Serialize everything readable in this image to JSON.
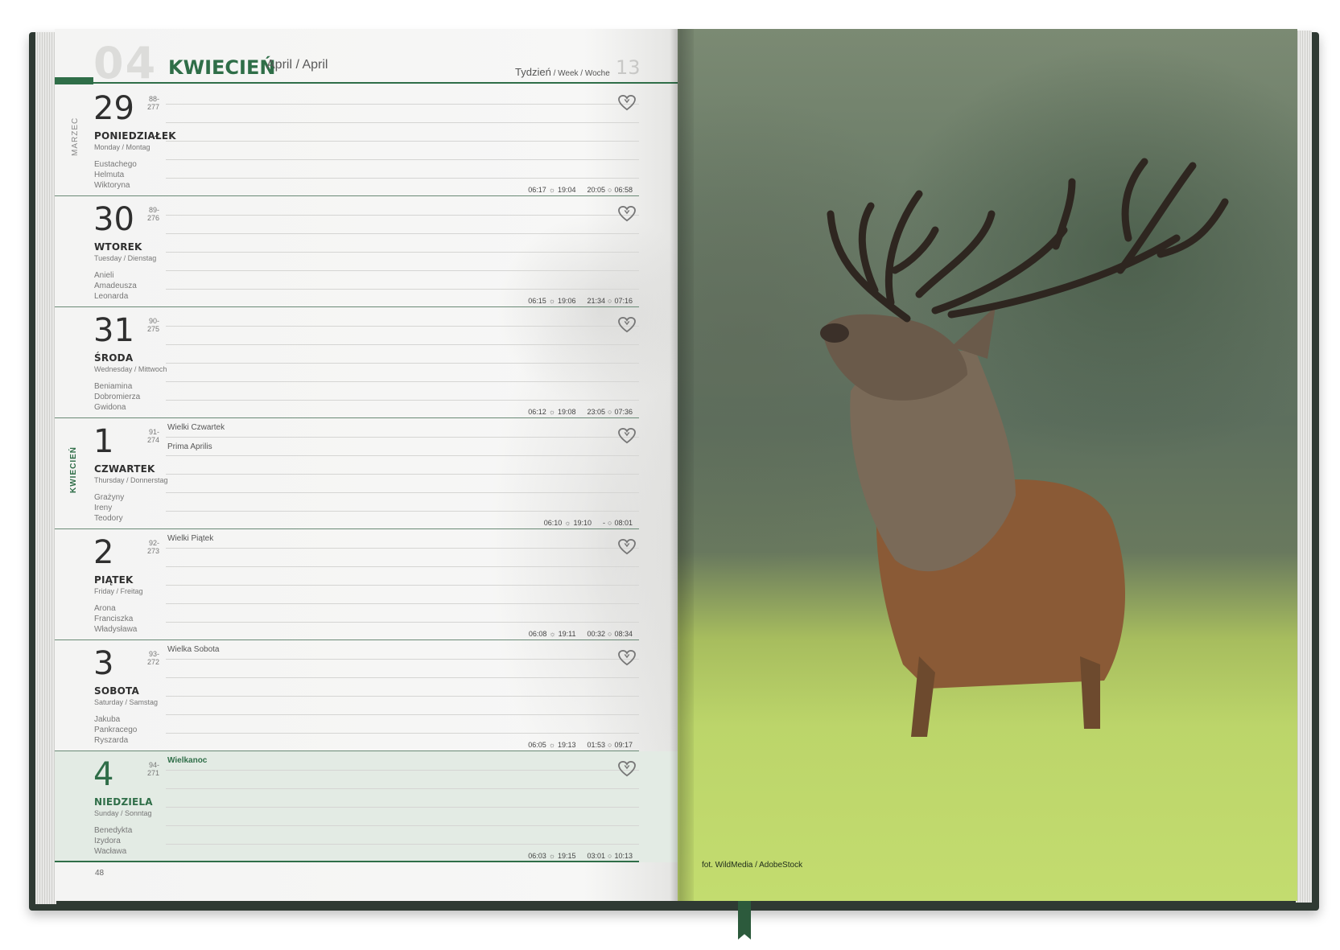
{
  "header": {
    "month_num": "04",
    "month_name": "KWIECIEŃ",
    "month_sub": "April / April",
    "week_label_main": "Tydzień",
    "week_label_sub": " / Week / Woche",
    "week_num": "13"
  },
  "side": {
    "prev_month": "MARZEC",
    "cur_month": "KWIECIEŃ"
  },
  "days": [
    {
      "num": "29",
      "idx": "88-277",
      "name": "PONIEDZIAŁEK",
      "en": "Monday / Montag",
      "names": [
        "Eustachego",
        "Helmuta",
        "Wiktoryna"
      ],
      "holiday": "",
      "holiday2": "",
      "sunrise": "06:17",
      "sunset": "19:04",
      "moonrise": "20:05",
      "moonset": "06:58"
    },
    {
      "num": "30",
      "idx": "89-276",
      "name": "WTOREK",
      "en": "Tuesday / Dienstag",
      "names": [
        "Anieli",
        "Amadeusza",
        "Leonarda"
      ],
      "holiday": "",
      "holiday2": "",
      "sunrise": "06:15",
      "sunset": "19:06",
      "moonrise": "21:34",
      "moonset": "07:16"
    },
    {
      "num": "31",
      "idx": "90-275",
      "name": "ŚRODA",
      "en": "Wednesday / Mittwoch",
      "names": [
        "Beniamina",
        "Dobromierza",
        "Gwidona"
      ],
      "holiday": "",
      "holiday2": "",
      "sunrise": "06:12",
      "sunset": "19:08",
      "moonrise": "23:05",
      "moonset": "07:36"
    },
    {
      "num": "1",
      "idx": "91-274",
      "name": "CZWARTEK",
      "en": "Thursday / Donnerstag",
      "names": [
        "Grażyny",
        "Ireny",
        "Teodory"
      ],
      "holiday": "Wielki Czwartek",
      "holiday2": "Prima Aprilis",
      "sunrise": "06:10",
      "sunset": "19:10",
      "moonrise": "-",
      "moonset": "08:01"
    },
    {
      "num": "2",
      "idx": "92-273",
      "name": "PIĄTEK",
      "en": "Friday / Freitag",
      "names": [
        "Arona",
        "Franciszka",
        "Władysława"
      ],
      "holiday": "Wielki Piątek",
      "holiday2": "",
      "sunrise": "06:08",
      "sunset": "19:11",
      "moonrise": "00:32",
      "moonset": "08:34"
    },
    {
      "num": "3",
      "idx": "93-272",
      "name": "SOBOTA",
      "en": "Saturday / Samstag",
      "names": [
        "Jakuba",
        "Pankracego",
        "Ryszarda"
      ],
      "holiday": "Wielka Sobota",
      "holiday2": "",
      "sunrise": "06:05",
      "sunset": "19:13",
      "moonrise": "01:53",
      "moonset": "09:17"
    },
    {
      "num": "4",
      "idx": "94-271",
      "name": "NIEDZIELA",
      "en": "Sunday / Sonntag",
      "names": [
        "Benedykta",
        "Izydora",
        "Wacława"
      ],
      "holiday": "Wielkanoc",
      "holiday2": "",
      "sunrise": "06:03",
      "sunset": "19:15",
      "moonrise": "03:01",
      "moonset": "10:13"
    }
  ],
  "page_number": "48",
  "photo_credit": "fot. WildMedia / AdobeStock",
  "colors": {
    "accent": "#2f6e48",
    "sunday_bg": "#e3ebe4"
  },
  "icons": {
    "favorite": "heart-icon",
    "sun": "sun-icon",
    "moon": "moon-icon"
  }
}
